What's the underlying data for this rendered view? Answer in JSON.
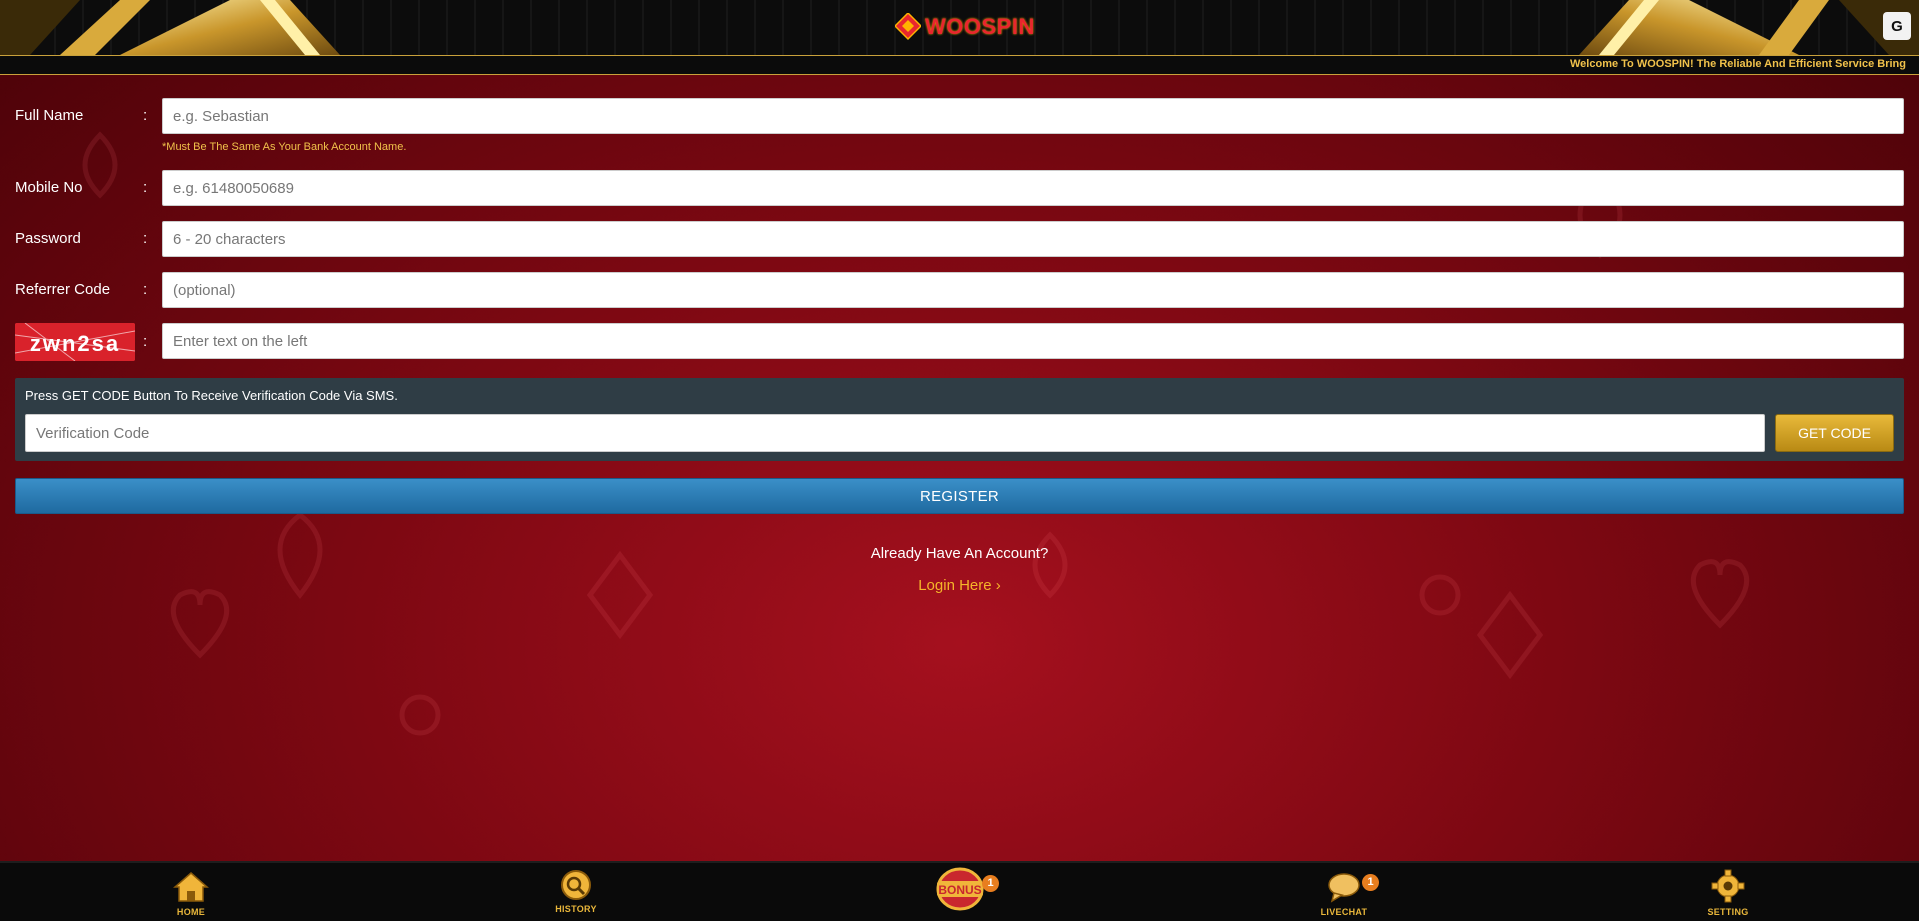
{
  "header": {
    "brand": "WOOSPIN",
    "translate_icon": "translate-icon",
    "marquee": "Welcome To WOOSPIN! The Reliable And Efficient Service Bring"
  },
  "form": {
    "full_name": {
      "label": "Full Name",
      "colon": ":",
      "placeholder": "e.g. Sebastian",
      "hint": "*Must Be The Same As Your Bank Account Name."
    },
    "mobile": {
      "label": "Mobile No",
      "colon": ":",
      "placeholder": "e.g. 61480050689"
    },
    "password": {
      "label": "Password",
      "colon": ":",
      "placeholder": "6 - 20 characters"
    },
    "referrer": {
      "label": "Referrer Code",
      "colon": ":",
      "placeholder": "(optional)"
    },
    "captcha": {
      "image_text": "zwn2sa",
      "colon": ":",
      "placeholder": "Enter text on the left"
    }
  },
  "verification": {
    "note": "Press GET CODE Button To Receive Verification Code Via SMS.",
    "placeholder": "Verification Code",
    "button": "GET CODE"
  },
  "register": {
    "button": "REGISTER"
  },
  "account": {
    "already": "Already Have An Account?",
    "login": "Login Here",
    "login_icon": "chevron-right-icon"
  },
  "bottom_nav": {
    "home": {
      "label": "HOME",
      "icon": "home-icon"
    },
    "history": {
      "label": "HISTORY",
      "icon": "history-icon"
    },
    "bonus": {
      "label": "BONUS",
      "icon": "bonus-icon",
      "badge": "1"
    },
    "livechat": {
      "label": "LIVECHAT",
      "icon": "chat-icon",
      "badge": "1"
    },
    "setting": {
      "label": "SETTING",
      "icon": "gear-icon"
    }
  },
  "colors": {
    "accent_gold": "#f1c24b",
    "brand_red": "#e8262e",
    "register_blue": "#2a7fb8",
    "background_red": "#8a0a14"
  }
}
